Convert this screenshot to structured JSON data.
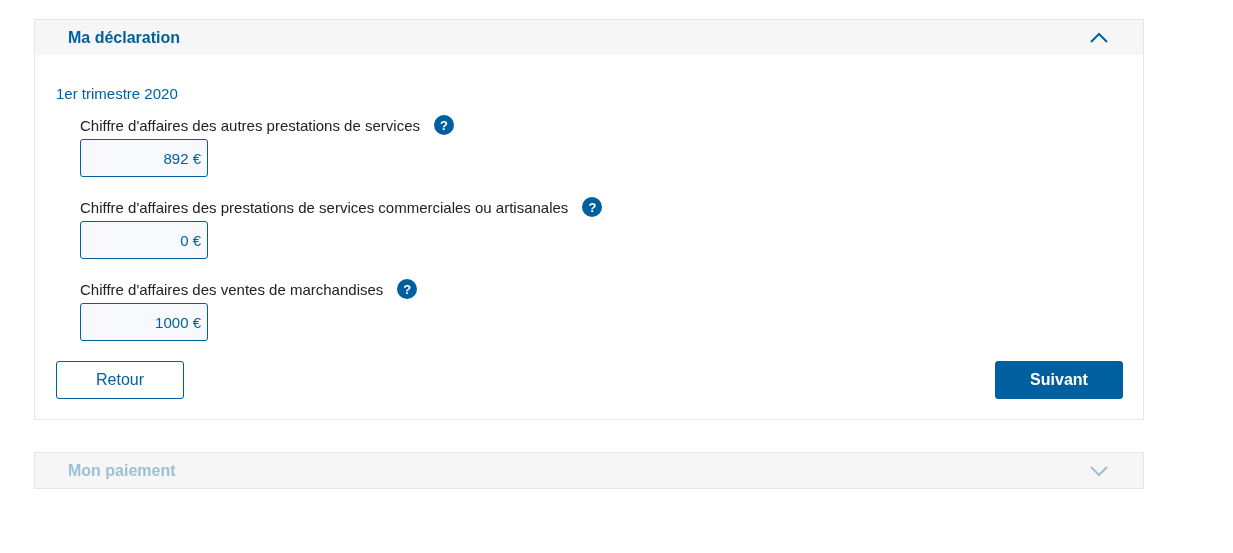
{
  "sections": [
    {
      "title": "Ma déclaration",
      "expanded": true,
      "disabled": false,
      "period": "1er trimestre 2020",
      "fields": [
        {
          "label": "Chiffre d'affaires des autres prestations de services",
          "value": "892 €",
          "help": "?"
        },
        {
          "label": "Chiffre d'affaires des prestations de services commerciales ou artisanales",
          "value": "0 €",
          "help": "?"
        },
        {
          "label": "Chiffre d'affaires des ventes de marchandises",
          "value": "1000 €",
          "help": "?"
        }
      ],
      "buttons": [
        {
          "label": "Retour",
          "kind": "secondary"
        },
        {
          "label": "Suivant",
          "kind": "primary"
        }
      ]
    },
    {
      "title": "Mon paiement",
      "expanded": false,
      "disabled": true
    }
  ]
}
